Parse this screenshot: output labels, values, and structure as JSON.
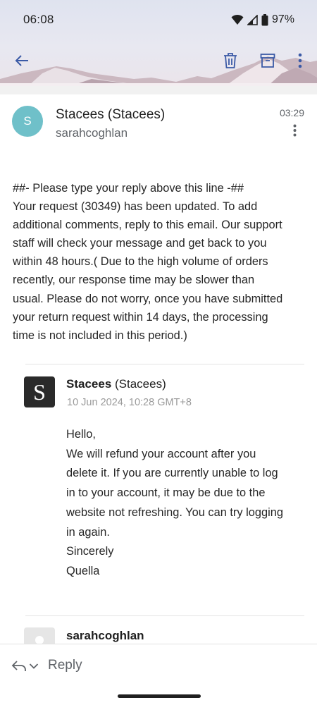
{
  "status_bar": {
    "time": "06:08",
    "battery_percent": "97%",
    "icons": [
      "wifi-icon",
      "signal-icon",
      "battery-icon"
    ]
  },
  "toolbar": {
    "icons": [
      "back-arrow-icon",
      "delete-icon",
      "archive-icon",
      "more-vert-icon"
    ]
  },
  "message": {
    "avatar_letter": "S",
    "avatar_color": "#6fc0c9",
    "sender_name": "Stacees (Stacees)",
    "sender_sub": "sarahcoghlan",
    "time": "03:29",
    "body_lines": [
      "##- Please type your reply above this line -##",
      "Your request (30349) has been updated. To add",
      "additional comments, reply to this email. Our support",
      "staff will check your message and get back to you",
      "within 48 hours.( Due to the high volume of orders",
      "recently, our response time may be slower than",
      "usual. Please do not worry, once you have submitted",
      "your return request within 14 days, the processing",
      "time is not included in this period.)"
    ]
  },
  "quoted": {
    "avatar_letter": "S",
    "sender_bold": "Stacees",
    "sender_rest": " (Stacees)",
    "date": "10 Jun 2024, 10:28 GMT+8",
    "body_lines": [
      "Hello,",
      "We will refund your account after you",
      "delete it. If you are currently unable to log",
      "in to your account, it may be due to the",
      "website not refreshing. You can try logging",
      "in again.",
      "Sincerely",
      "Quella"
    ]
  },
  "quoted2": {
    "sender": "sarahcoghlan"
  },
  "reply_bar": {
    "label": "Reply"
  }
}
